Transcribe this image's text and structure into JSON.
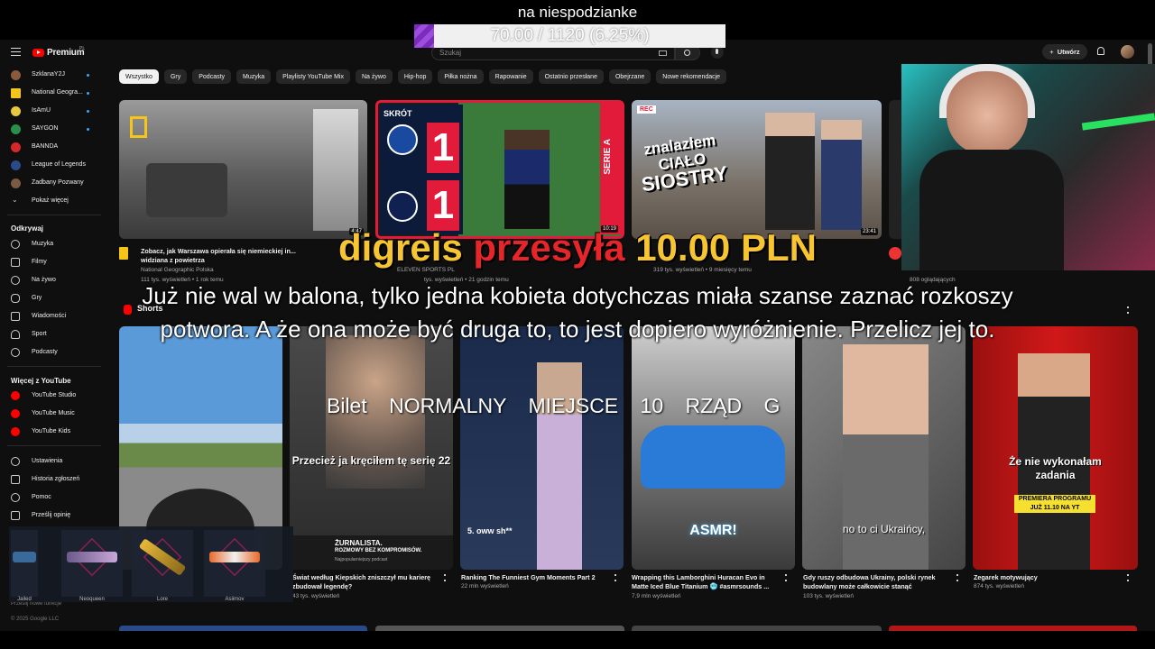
{
  "stream_overlay": {
    "goal_title": "na niespodzianke",
    "goal_progress_text": "70.00 / 1120 (6.25%)",
    "goal_progress_fraction": 0.0625,
    "donation": {
      "name": "digreis",
      "verb": "przesyła",
      "amount": "10.00 PLN"
    },
    "message": "Już nie wal w balona, tylko jedna kobieta dotychczas miała szanse zaznać rozkoszy potwora. A że ona może być druga to, to jest dopiero wyróżnienie. Przelicz jej to.",
    "ticket": "Bilet NORMALNY MIEJSCE 10 RZĄD G",
    "inventory": [
      "Jailed",
      "Neoqueen",
      "Lore",
      "Asiimov"
    ]
  },
  "topbar": {
    "logo_text": "Premium",
    "logo_region": "PL",
    "search_placeholder": "Szukaj",
    "create_label": "Utwórz"
  },
  "sidebar": {
    "subscriptions": [
      {
        "label": "SzklanaY2J",
        "dot": true,
        "color": "#8b5a3c"
      },
      {
        "label": "National Geogra...",
        "dot": true,
        "color": "#f5c518"
      },
      {
        "label": "IsAmU",
        "dot": true,
        "color": "#e8c840"
      },
      {
        "label": "SAYGON",
        "dot": true,
        "color": "#2a8f4a"
      },
      {
        "label": "BANNDA",
        "dot": false,
        "color": "#d62828"
      },
      {
        "label": "League of Legends",
        "dot": false,
        "color": "#2a4a8a"
      },
      {
        "label": "Zadbany Pozwany",
        "dot": false,
        "color": "#7a5a40"
      },
      {
        "label": "Pokaż więcej",
        "dot": false,
        "color": ""
      }
    ],
    "explore_heading": "Odkrywaj",
    "explore": [
      "Muzyka",
      "Filmy",
      "Na żywo",
      "Gry",
      "Wiadomości",
      "Sport",
      "Podcasty"
    ],
    "more_heading": "Więcej z YouTube",
    "more": [
      "YouTube Studio",
      "YouTube Music",
      "YouTube Kids"
    ],
    "settings": [
      "Ustawienia",
      "Historia zgłoszeń",
      "Pomoc",
      "Prześlij opinię"
    ],
    "footer_line": "Prześlij nowe funkcje",
    "copyright": "© 2025 Google LLC"
  },
  "chips": [
    "Wszystko",
    "Gry",
    "Podcasty",
    "Muzyka",
    "Playlisty YouTube Mix",
    "Na żywo",
    "Hip-hop",
    "Piłka nożna",
    "Rapowanie",
    "Ostatnio przesłane",
    "Obejrzane",
    "Nowe rekomendacje"
  ],
  "videos": [
    {
      "title": "Zobacz, jak Warszawa opierała się niemieckiej in...",
      "title2": "widziana z powietrza",
      "channel": "National Geographic Polska",
      "meta": "111 tys. wyświetleń • 1 rok temu",
      "duration": "4:47"
    },
    {
      "title": "SKRÓT",
      "title2": "",
      "channel": "ELEVEN SPORTS PL",
      "meta": "tys. wyświetleń • 21 godzin temu",
      "duration": "10:19",
      "score1": "1",
      "score2": "1",
      "banner": "SERIE A"
    },
    {
      "title": "znalazłem ciało siostry sekret b",
      "title2": "",
      "channel": "",
      "meta": "319 tys. wyświetleń • 9 miesięcy temu",
      "duration": "23:41",
      "rec": "REC",
      "overlay1": "znalazłem",
      "overlay2": "CIAŁO",
      "overlay3": "SIOSTRY"
    },
    {
      "title": "",
      "title2": "",
      "channel": "",
      "meta": "808 oglądających",
      "duration": ""
    }
  ],
  "shorts_heading": "Shorts",
  "shorts": [
    {
      "title": "",
      "meta": "",
      "overlay": ""
    },
    {
      "title": "Świat według Kiepskich zniszczył mu karierę",
      "title2": "zbudował legendę?",
      "meta": "43 tys. wyświetleń",
      "overlay": "Przecież ja kręciłem tę serię 22",
      "badge1": "ŻURNALISTA.",
      "badge2": "ROZMOWY BEZ KOMPROMISÓW.",
      "badge3": "Najpopularniejszy podcast"
    },
    {
      "title": "Ranking The Funniest Gym Moments Part 2",
      "meta": "22 mln wyświetleń",
      "overlay": "5. oww sh**"
    },
    {
      "title": "Wrapping this Lamborghini Huracan Evo in",
      "title2": "Matte Iced Blue Titanium 🥶 #asmrsounds ...",
      "meta": "7,9 mln wyświetleń",
      "overlay": "ASMR!"
    },
    {
      "title": "Gdy ruszy odbudowa Ukrainy, polski rynek",
      "title2": "budowlany może całkowicie stanąć",
      "meta": "103 tys. wyświetleń",
      "overlay": "no to ci Ukraińcy,"
    },
    {
      "title": "Zegarek motywujący",
      "meta": "874 tys. wyświetleń",
      "overlay": "Że nie wykonałam zadania",
      "badge1": "PREMIERA PROGRAMU",
      "badge2": "JUŻ 11.10 NA YT"
    }
  ]
}
